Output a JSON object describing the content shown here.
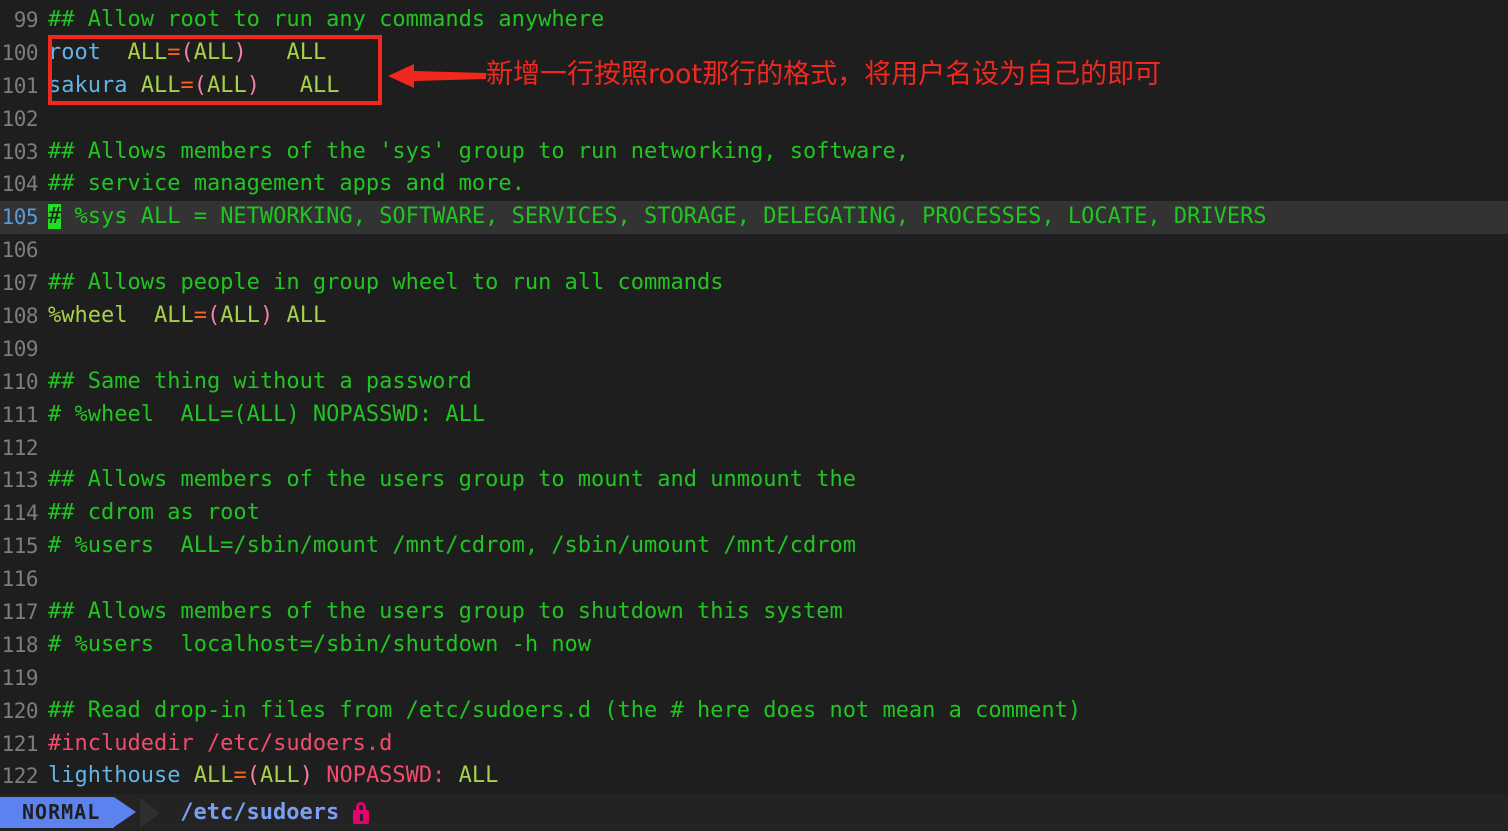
{
  "editor": {
    "background": "#1e1e1e",
    "current_line_background": "#333333",
    "cursor_color": "#22dd22",
    "lines": [
      {
        "num": "99",
        "current": false,
        "tokens": [
          {
            "t": "## Allow root to run any commands anywhere",
            "c": "c-comment"
          }
        ]
      },
      {
        "num": "100",
        "current": false,
        "tokens": [
          {
            "t": "root",
            "c": "c-user"
          },
          {
            "t": "  ",
            "c": "c-plain"
          },
          {
            "t": "ALL",
            "c": "c-all"
          },
          {
            "t": "=",
            "c": "c-eq"
          },
          {
            "t": "(",
            "c": "c-paren"
          },
          {
            "t": "ALL",
            "c": "c-all"
          },
          {
            "t": ")",
            "c": "c-paren"
          },
          {
            "t": "   ",
            "c": "c-plain"
          },
          {
            "t": "ALL",
            "c": "c-all"
          }
        ]
      },
      {
        "num": "101",
        "current": false,
        "tokens": [
          {
            "t": "sakura",
            "c": "c-user"
          },
          {
            "t": " ",
            "c": "c-plain"
          },
          {
            "t": "ALL",
            "c": "c-all"
          },
          {
            "t": "=",
            "c": "c-eq"
          },
          {
            "t": "(",
            "c": "c-paren"
          },
          {
            "t": "ALL",
            "c": "c-all"
          },
          {
            "t": ")",
            "c": "c-paren"
          },
          {
            "t": "   ",
            "c": "c-plain"
          },
          {
            "t": "ALL",
            "c": "c-all"
          }
        ]
      },
      {
        "num": "102",
        "current": false,
        "tokens": []
      },
      {
        "num": "103",
        "current": false,
        "tokens": [
          {
            "t": "## Allows members of the 'sys' group to run networking, software,",
            "c": "c-comment"
          }
        ]
      },
      {
        "num": "104",
        "current": false,
        "tokens": [
          {
            "t": "## service management apps and more.",
            "c": "c-comment"
          }
        ]
      },
      {
        "num": "105",
        "current": true,
        "tokens": [
          {
            "t": "#",
            "c": "c-comment",
            "cursor": true
          },
          {
            "t": " %sys ALL = NETWORKING, SOFTWARE, SERVICES, STORAGE, DELEGATING, PROCESSES, LOCATE, DRIVERS",
            "c": "c-comment"
          }
        ]
      },
      {
        "num": "106",
        "current": false,
        "tokens": []
      },
      {
        "num": "107",
        "current": false,
        "tokens": [
          {
            "t": "## Allows people in group wheel to run all commands",
            "c": "c-comment"
          }
        ]
      },
      {
        "num": "108",
        "current": false,
        "tokens": [
          {
            "t": "%wheel",
            "c": "c-all"
          },
          {
            "t": "  ",
            "c": "c-plain"
          },
          {
            "t": "ALL",
            "c": "c-all"
          },
          {
            "t": "=",
            "c": "c-eq"
          },
          {
            "t": "(",
            "c": "c-paren"
          },
          {
            "t": "ALL",
            "c": "c-all"
          },
          {
            "t": ")",
            "c": "c-paren"
          },
          {
            "t": " ",
            "c": "c-plain"
          },
          {
            "t": "ALL",
            "c": "c-all"
          }
        ]
      },
      {
        "num": "109",
        "current": false,
        "tokens": []
      },
      {
        "num": "110",
        "current": false,
        "tokens": [
          {
            "t": "## Same thing without a password",
            "c": "c-comment"
          }
        ]
      },
      {
        "num": "111",
        "current": false,
        "tokens": [
          {
            "t": "# %wheel  ALL=(ALL) NOPASSWD: ALL",
            "c": "c-comment"
          }
        ]
      },
      {
        "num": "112",
        "current": false,
        "tokens": []
      },
      {
        "num": "113",
        "current": false,
        "tokens": [
          {
            "t": "## Allows members of the users group to mount and unmount the",
            "c": "c-comment"
          }
        ]
      },
      {
        "num": "114",
        "current": false,
        "tokens": [
          {
            "t": "## cdrom as root",
            "c": "c-comment"
          }
        ]
      },
      {
        "num": "115",
        "current": false,
        "tokens": [
          {
            "t": "# %users  ALL=/sbin/mount /mnt/cdrom, /sbin/umount /mnt/cdrom",
            "c": "c-comment"
          }
        ]
      },
      {
        "num": "116",
        "current": false,
        "tokens": []
      },
      {
        "num": "117",
        "current": false,
        "tokens": [
          {
            "t": "## Allows members of the users group to shutdown this system",
            "c": "c-comment"
          }
        ]
      },
      {
        "num": "118",
        "current": false,
        "tokens": [
          {
            "t": "# %users  localhost=/sbin/shutdown -h now",
            "c": "c-comment"
          }
        ]
      },
      {
        "num": "119",
        "current": false,
        "tokens": []
      },
      {
        "num": "120",
        "current": false,
        "tokens": [
          {
            "t": "## Read drop-in files from /etc/sudoers.d (the # here does not mean a comment)",
            "c": "c-comment"
          }
        ]
      },
      {
        "num": "121",
        "current": false,
        "tokens": [
          {
            "t": "#includedir /etc/sudoers.d",
            "c": "c-kw"
          }
        ]
      },
      {
        "num": "122",
        "current": false,
        "tokens": [
          {
            "t": "lighthouse",
            "c": "c-user"
          },
          {
            "t": " ",
            "c": "c-plain"
          },
          {
            "t": "ALL",
            "c": "c-all"
          },
          {
            "t": "=",
            "c": "c-eq"
          },
          {
            "t": "(",
            "c": "c-paren"
          },
          {
            "t": "ALL",
            "c": "c-all"
          },
          {
            "t": ")",
            "c": "c-paren"
          },
          {
            "t": " ",
            "c": "c-plain"
          },
          {
            "t": "NOPASSWD:",
            "c": "c-kw"
          },
          {
            "t": " ",
            "c": "c-plain"
          },
          {
            "t": "ALL",
            "c": "c-all"
          }
        ]
      }
    ]
  },
  "annotation": {
    "color": "#f0281e",
    "note_text": "新增一行按照root那行的格式，将用户名设为自己的即可",
    "highlight_box_lines": [
      "100",
      "101"
    ]
  },
  "statusbar": {
    "mode": "NORMAL",
    "file": "/etc/sudoers",
    "readonly_icon": "lock-icon",
    "mode_color": "#5b82ef",
    "file_color": "#7c9ff2",
    "lock_color": "#e8006e"
  }
}
